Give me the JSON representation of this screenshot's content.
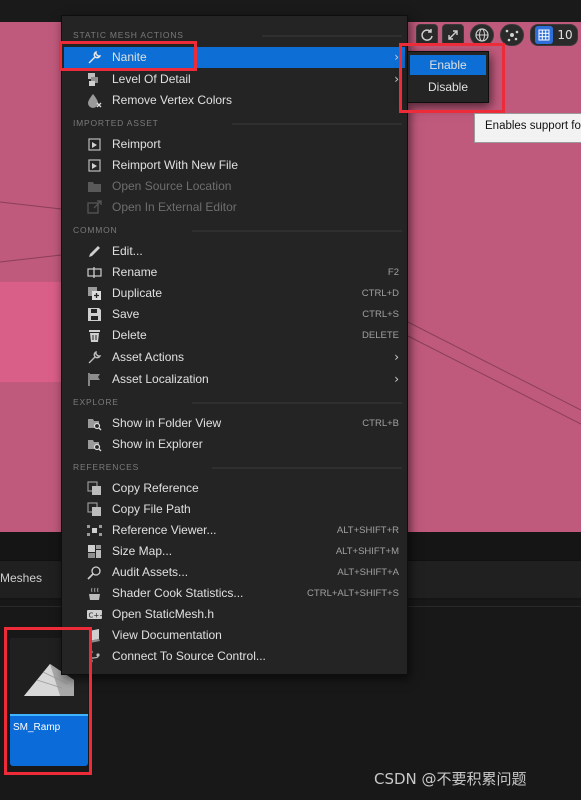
{
  "viewport": {
    "toolbar": {
      "grid_snap_value": "10",
      "icons": [
        "refresh-icon",
        "maximize-icon",
        "globe-icon",
        "surface-snap-icon",
        "grid-icon"
      ]
    }
  },
  "content_browser": {
    "tab_label": "Meshes",
    "asset": {
      "name": "SM_Ramp"
    }
  },
  "context_menu": {
    "sections": {
      "static_mesh_actions": "STATIC MESH ACTIONS",
      "imported_asset": "IMPORTED ASSET",
      "common": "COMMON",
      "explore": "EXPLORE",
      "references": "REFERENCES"
    },
    "items": {
      "nanite": {
        "label": "Nanite",
        "icon": "wrench-icon"
      },
      "level_of_detail": {
        "label": "Level Of Detail",
        "icon": "lod-icon"
      },
      "remove_vertex_colors": {
        "label": "Remove Vertex Colors",
        "icon": "paint-drop-icon"
      },
      "reimport": {
        "label": "Reimport",
        "icon": "reimport-icon"
      },
      "reimport_new_file": {
        "label": "Reimport With New File",
        "icon": "reimport-icon"
      },
      "open_source_location": {
        "label": "Open Source Location",
        "icon": "folder-icon"
      },
      "open_external_editor": {
        "label": "Open In External Editor",
        "icon": "external-editor-icon"
      },
      "edit": {
        "label": "Edit...",
        "icon": "pencil-icon"
      },
      "rename": {
        "label": "Rename",
        "icon": "rename-icon",
        "shortcut": "F2"
      },
      "duplicate": {
        "label": "Duplicate",
        "icon": "duplicate-icon",
        "shortcut": "CTRL+D"
      },
      "save": {
        "label": "Save",
        "icon": "save-icon",
        "shortcut": "CTRL+S"
      },
      "delete": {
        "label": "Delete",
        "icon": "trash-icon",
        "shortcut": "DELETE"
      },
      "asset_actions": {
        "label": "Asset Actions",
        "icon": "wrench-icon"
      },
      "asset_localization": {
        "label": "Asset Localization",
        "icon": "flag-icon"
      },
      "show_folder_view": {
        "label": "Show in Folder View",
        "icon": "folder-search-icon",
        "shortcut": "CTRL+B"
      },
      "show_explorer": {
        "label": "Show in Explorer",
        "icon": "folder-search-icon"
      },
      "copy_reference": {
        "label": "Copy Reference",
        "icon": "copy-icon"
      },
      "copy_file_path": {
        "label": "Copy File Path",
        "icon": "copy-icon"
      },
      "reference_viewer": {
        "label": "Reference Viewer...",
        "icon": "reference-viewer-icon",
        "shortcut": "ALT+SHIFT+R"
      },
      "size_map": {
        "label": "Size Map...",
        "icon": "size-map-icon",
        "shortcut": "ALT+SHIFT+M"
      },
      "audit_assets": {
        "label": "Audit Assets...",
        "icon": "audit-icon",
        "shortcut": "ALT+SHIFT+A"
      },
      "shader_cook_stats": {
        "label": "Shader Cook Statistics...",
        "icon": "shader-cook-icon",
        "shortcut": "CTRL+ALT+SHIFT+S"
      },
      "open_staticmesh_h": {
        "label": "Open StaticMesh.h",
        "icon": "cpp-file-icon"
      },
      "view_documentation": {
        "label": "View Documentation",
        "icon": "book-icon"
      },
      "connect_source_control": {
        "label": "Connect To Source Control...",
        "icon": "source-control-icon"
      }
    }
  },
  "submenu": {
    "enable": "Enable",
    "disable": "Disable"
  },
  "tooltip": {
    "text": "Enables support fo"
  },
  "watermark": {
    "text": "CSDN @不要积累问题"
  },
  "colors": {
    "viewport_bg": "#c05a7c",
    "menu_bg": "#242424",
    "accent_blue": "#0d6fd6",
    "annotation_red": "#ee2b38"
  }
}
